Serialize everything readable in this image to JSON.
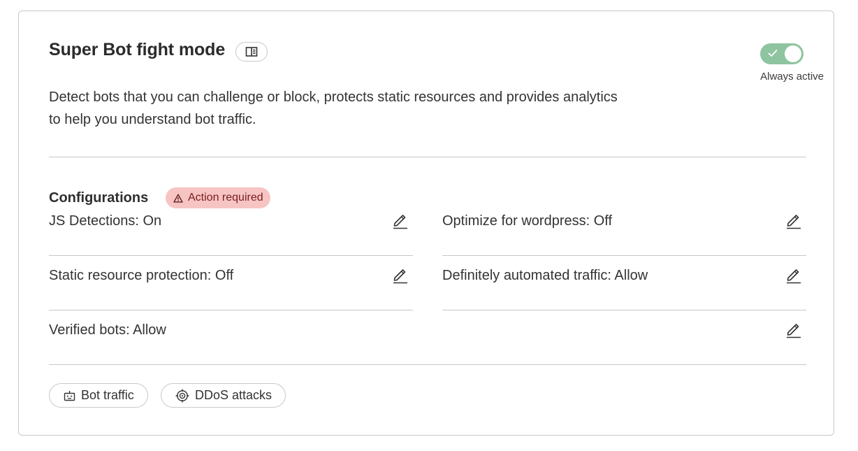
{
  "header": {
    "title": "Super Bot fight mode",
    "toggle_state": "on",
    "toggle_status_label": "Always active",
    "description": "Detect bots that you can challenge or block, protects static resources and provides analytics to help you understand bot traffic."
  },
  "configurations": {
    "title": "Configurations",
    "badge_label": "Action required",
    "settings": [
      {
        "label": "JS Detections: On"
      },
      {
        "label": "Optimize for wordpress: Off"
      },
      {
        "label": "Static resource protection: Off"
      },
      {
        "label": "Definitely automated traffic: Allow"
      },
      {
        "label": "Verified bots: Allow"
      }
    ]
  },
  "links": [
    {
      "label": "Bot traffic",
      "icon": "robot-icon"
    },
    {
      "label": "DDoS attacks",
      "icon": "target-icon"
    }
  ],
  "colors": {
    "toggle_on": "#8ec49f",
    "badge_bg": "#f7c4c4",
    "badge_text": "#7a1c1c",
    "divider": "#c7c7c7"
  }
}
